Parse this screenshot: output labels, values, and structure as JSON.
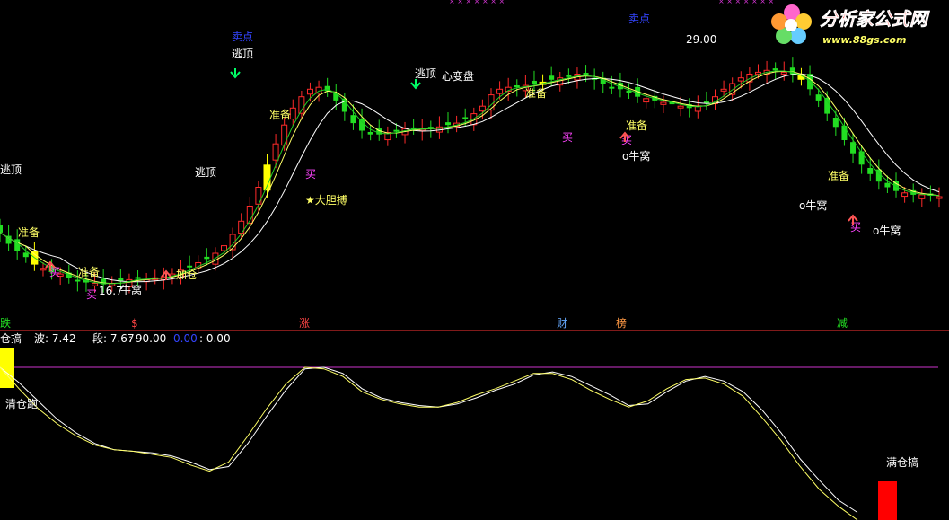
{
  "logo": {
    "title": "分析家公式网",
    "url": "www.88gs.com"
  },
  "colors": {
    "up": "#ff2a2a",
    "down": "#22dd22",
    "fill_yellow": "#ffff00",
    "ma_white": "#ffffff",
    "ma_yellow": "#ffff66",
    "ma_green": "#22cc22",
    "purple_line": "#cc33cc",
    "text_yellow": "#ffff66",
    "text_magenta": "#ff44ff",
    "text_blue": "#3344ff"
  },
  "upper_annotations": {
    "sell_1": "卖点",
    "sell_2": "卖点",
    "escape_1": "逃顶",
    "escape_2": "逃顶",
    "escape_3": "逃顶",
    "escape_4": "逃顶",
    "prepare_1": "准备",
    "prepare_2": "准备",
    "prepare_3": "准备",
    "prepare_4": "准备",
    "prepare_5": "准备",
    "prepare_6": "准备",
    "buy_1": "买",
    "buy_2": "买",
    "buy_3": "买",
    "buy_4": "买",
    "buy_5": "买",
    "buy_6": "买",
    "nest_1": "牛窝",
    "nest_2": "o牛窝",
    "nest_3": "o牛窝",
    "nest_4": "o牛窝",
    "bold_buy": "★大胆搏",
    "heart": "心变盘",
    "add_position": "加仓",
    "peak_price": "29.00",
    "low_price": "16.7"
  },
  "bottom_markers": [
    "跌",
    "$",
    "涨",
    "财",
    "榜",
    "减"
  ],
  "indicator_header": {
    "name": "仓搞",
    "wave": "波: 7.42",
    "segment": "段: 7.67",
    "v1": ": 90.00",
    "v2": "0.00",
    "v3": ": 0.00"
  },
  "lower_annotations": {
    "clear_run": "清仓跑",
    "full_position": "满仓搞"
  },
  "chart_data": [
    {
      "type": "candlestick",
      "title": "",
      "price_labels": [
        29.0,
        16.7
      ],
      "close": [
        19.6,
        19.0,
        18.6,
        18.3,
        17.9,
        17.7,
        17.5,
        17.4,
        17.2,
        17.0,
        16.95,
        16.9,
        16.85,
        16.9,
        17.0,
        17.1,
        17.2,
        17.1,
        17.2,
        17.25,
        17.4,
        17.6,
        17.8,
        18.0,
        18.2,
        18.5,
        18.9,
        19.5,
        20.2,
        21.0,
        22.0,
        23.2,
        24.3,
        25.3,
        26.2,
        26.8,
        27.2,
        27.3,
        27.1,
        26.6,
        26.0,
        25.4,
        25.0,
        24.8,
        24.8,
        24.9,
        25.0,
        25.1,
        25.1,
        25.1,
        25.1,
        25.2,
        25.3,
        25.4,
        25.6,
        25.9,
        26.3,
        26.9,
        27.2,
        27.3,
        27.3,
        27.4,
        27.5,
        27.6,
        27.7,
        27.8,
        27.9,
        28.0,
        27.9,
        27.7,
        27.5,
        27.3,
        27.2,
        27.0,
        26.8,
        26.7,
        26.6,
        26.5,
        26.4,
        26.3,
        26.2,
        26.3,
        26.5,
        26.8,
        27.2,
        27.5,
        27.8,
        28.0,
        28.1,
        28.2,
        28.2,
        28.1,
        28.0,
        27.7,
        27.2,
        26.6,
        25.9,
        25.2,
        24.5,
        23.8,
        23.2,
        22.7,
        22.3,
        22.0,
        21.8,
        21.7,
        21.6,
        21.6,
        21.55,
        21.5
      ],
      "overlay_lines": [
        "white",
        "yellow",
        "green"
      ],
      "grid": false
    },
    {
      "type": "line",
      "title": "仓搞",
      "series": [
        {
          "name": "波",
          "values": [
            100,
            90,
            78,
            66,
            57,
            50,
            46,
            45,
            44,
            42,
            38,
            33,
            35,
            50,
            68,
            85,
            99,
            100,
            96,
            86,
            80,
            77,
            75,
            74,
            76,
            80,
            85,
            89,
            95,
            97,
            94,
            88,
            82,
            75,
            76,
            84,
            91,
            94,
            91,
            84,
            72,
            57,
            40,
            26,
            13,
            5
          ]
        },
        {
          "name": "段",
          "values": [
            100,
            86,
            73,
            63,
            55,
            49,
            46,
            45,
            43,
            41,
            36,
            32,
            38,
            55,
            73,
            89,
            100,
            99,
            94,
            84,
            79,
            76,
            74,
            74,
            77,
            82,
            86,
            91,
            96,
            96,
            92,
            85,
            79,
            74,
            78,
            86,
            92,
            93,
            89,
            81,
            67,
            52,
            35,
            20,
            9,
            0
          ]
        }
      ],
      "ylim": [
        0,
        100
      ],
      "reference_line": 90,
      "grid": false
    }
  ]
}
